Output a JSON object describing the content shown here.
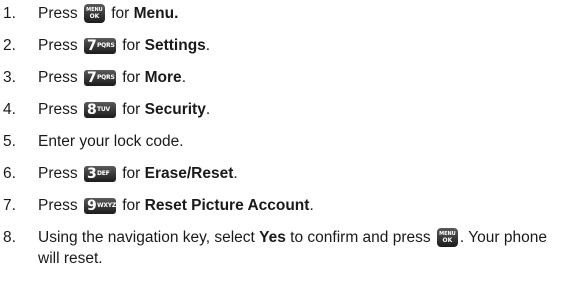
{
  "steps": [
    {
      "number": "1.",
      "parts": [
        {
          "t": "Press "
        },
        {
          "key": "menu"
        },
        {
          "t": " for "
        },
        {
          "t": "Menu.",
          "b": true
        }
      ]
    },
    {
      "number": "2.",
      "parts": [
        {
          "t": "Press "
        },
        {
          "key": "7"
        },
        {
          "t": " for "
        },
        {
          "t": "Settings",
          "b": true
        },
        {
          "t": "."
        }
      ]
    },
    {
      "number": "3.",
      "parts": [
        {
          "t": "Press "
        },
        {
          "key": "7"
        },
        {
          "t": " for "
        },
        {
          "t": "More",
          "b": true
        },
        {
          "t": "."
        }
      ]
    },
    {
      "number": "4.",
      "parts": [
        {
          "t": "Press "
        },
        {
          "key": "8"
        },
        {
          "t": " for "
        },
        {
          "t": "Security",
          "b": true
        },
        {
          "t": "."
        }
      ]
    },
    {
      "number": "5.",
      "parts": [
        {
          "t": "Enter your lock code."
        }
      ]
    },
    {
      "number": "6.",
      "parts": [
        {
          "t": "Press "
        },
        {
          "key": "3"
        },
        {
          "t": " for "
        },
        {
          "t": "Erase/Reset",
          "b": true
        },
        {
          "t": "."
        }
      ]
    },
    {
      "number": "7.",
      "parts": [
        {
          "t": "Press "
        },
        {
          "key": "9"
        },
        {
          "t": " for "
        },
        {
          "t": "Reset Picture Account",
          "b": true
        },
        {
          "t": "."
        }
      ]
    },
    {
      "number": "8.",
      "parts": [
        {
          "t": "Using the navigation key, select "
        },
        {
          "t": "Yes",
          "b": true
        },
        {
          "t": " to confirm and press "
        },
        {
          "key": "menu"
        },
        {
          "t": ". Your phone will reset."
        }
      ]
    }
  ],
  "keys": {
    "menu": {
      "top": "MENU",
      "bottom": "OK",
      "icon": "menu-ok-key-icon"
    },
    "3": {
      "digit": "3",
      "letters": "DEF",
      "icon": "key-3-def-icon"
    },
    "7": {
      "digit": "7",
      "letters": "PQRS",
      "icon": "key-7-pqrs-icon"
    },
    "8": {
      "digit": "8",
      "letters": "TUV",
      "icon": "key-8-tuv-icon"
    },
    "9": {
      "digit": "9",
      "letters": "WXYZ",
      "icon": "key-9-wxyz-icon"
    }
  }
}
